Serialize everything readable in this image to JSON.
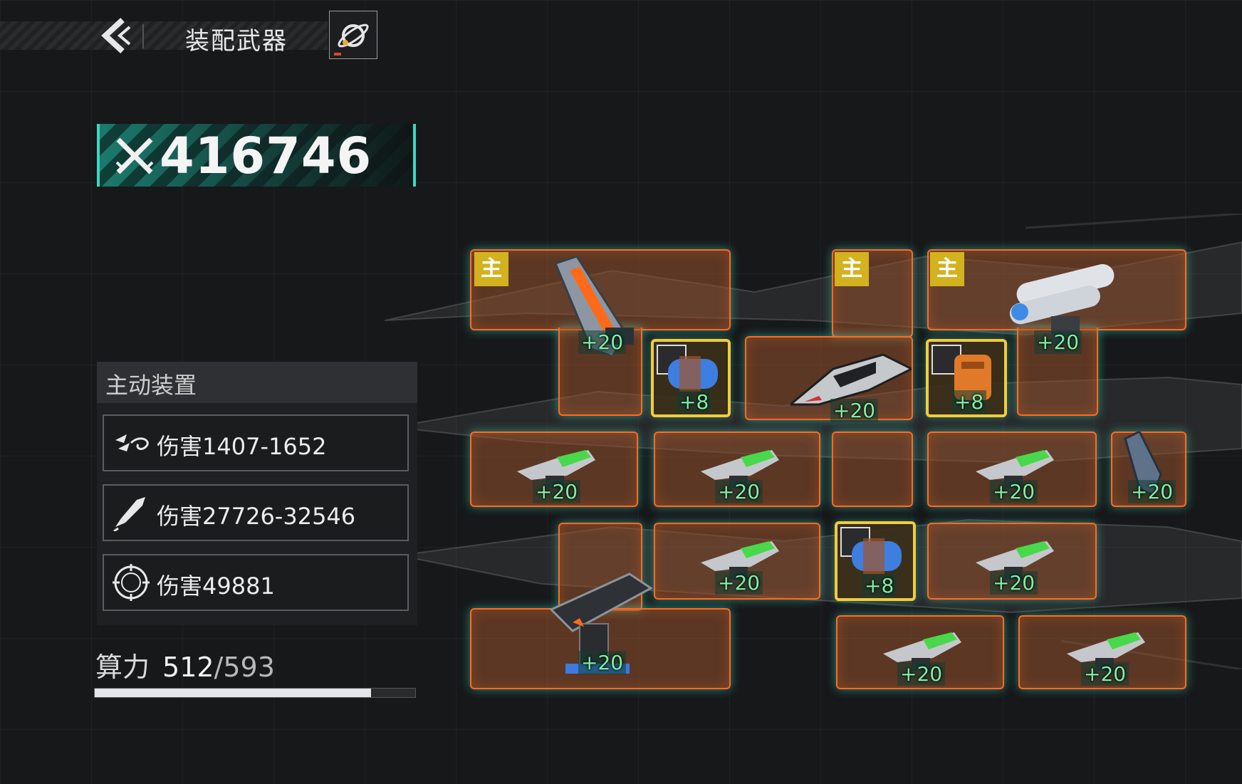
{
  "header": {
    "title": "装配武器",
    "back_icon": "chevron-left-icon",
    "ship_icon": "planet-ship-icon"
  },
  "power": {
    "icon": "crossed-swords-icon",
    "value": "416746",
    "accent": "#1b7b6e"
  },
  "active_devices": {
    "title": "主动装置",
    "items": [
      {
        "icon": "drone-swarm-icon",
        "label": "伤害1407-1652"
      },
      {
        "icon": "missile-icon",
        "label": "伤害27726-32546"
      },
      {
        "icon": "target-reticle-icon",
        "label": "伤害49881"
      }
    ]
  },
  "compute": {
    "label": "算力",
    "current": "512",
    "max": "/593",
    "fill_fraction": 0.863
  },
  "slots": {
    "main_badge": "主",
    "labels": {
      "railgun": "+20",
      "capsule1": "+8",
      "fighter": "+20",
      "capsule2": "+8",
      "twin_cannon": "+20",
      "g1": "+20",
      "g2": "+20",
      "g3": "+20",
      "g4": "+20",
      "g5": "+20",
      "capsule3": "+8",
      "g6": "+20",
      "turret": "+20",
      "g7": "+20",
      "g8": "+20"
    }
  },
  "colors": {
    "slot_border": "#ff6a22",
    "gold_border": "#f2cc3a",
    "label_green": "#7ef0a8",
    "main_badge": "#d3b21f"
  }
}
